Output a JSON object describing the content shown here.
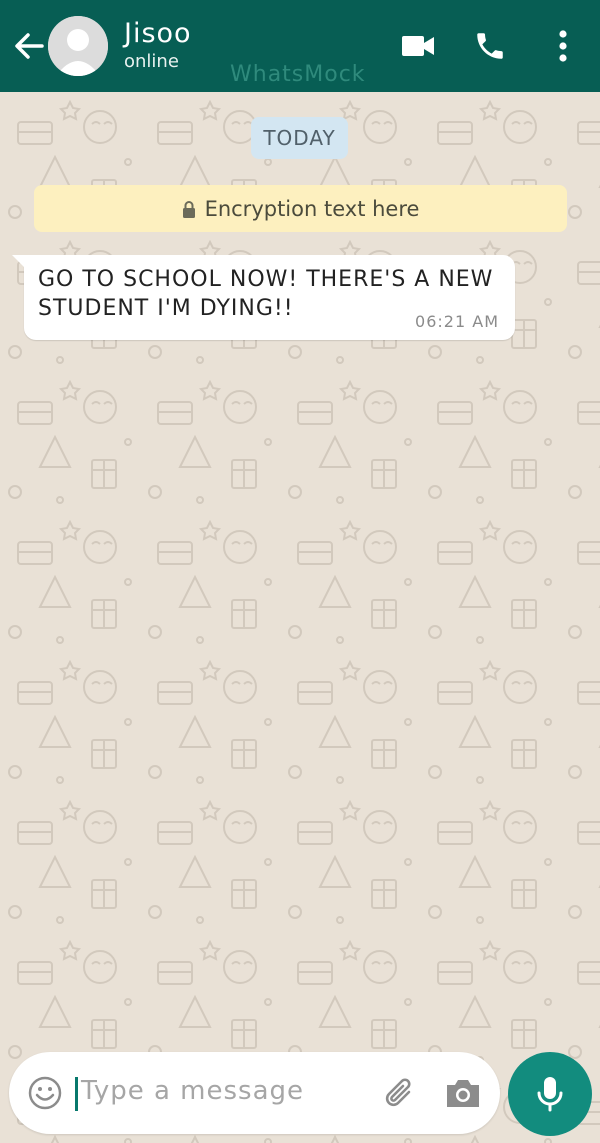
{
  "header": {
    "contact_name": "Jisoo",
    "contact_status": "online",
    "watermark": "WhatsMock",
    "icons": [
      "back-arrow-icon",
      "avatar-placeholder-icon",
      "video-call-icon",
      "phone-icon",
      "more-vertical-icon"
    ]
  },
  "chat": {
    "date_label": "TODAY",
    "encryption_text": "Encryption text here",
    "messages": [
      {
        "text": "GO TO SCHOOL NOW! THERE'S A NEW STUDENT I'M DYING!!",
        "time": "06:21 AM",
        "direction": "incoming"
      }
    ]
  },
  "composer": {
    "placeholder": "Type a message",
    "icons": [
      "emoji-icon",
      "attach-icon",
      "camera-icon",
      "mic-icon"
    ]
  },
  "colors": {
    "header": "#075e54",
    "accent": "#128c7e",
    "wallpaper": "#e9e1d6",
    "date_chip": "#d3e6f2",
    "encryption_bg": "#fdf0bf",
    "bubble": "#ffffff"
  }
}
